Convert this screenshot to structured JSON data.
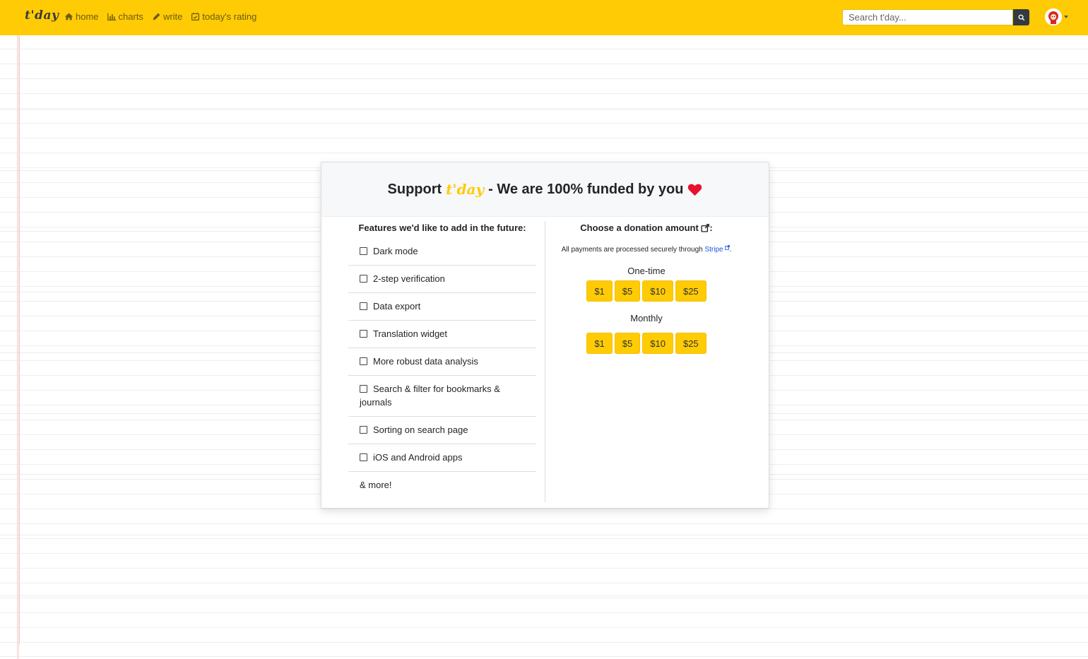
{
  "navbar": {
    "brand": "t'day",
    "links": [
      {
        "label": "home",
        "icon": "home-icon"
      },
      {
        "label": "charts",
        "icon": "bar-chart-icon"
      },
      {
        "label": "write",
        "icon": "pencil-icon"
      },
      {
        "label": "today's rating",
        "icon": "calendar-check-icon"
      }
    ],
    "search_placeholder": "Search t'day...",
    "accent_color": "#ffcb05"
  },
  "support": {
    "title_prefix": "Support",
    "title_brand": "t'day",
    "title_suffix": "- We are 100% funded by you",
    "heart_color": "#e8112d",
    "features_title": "Features we'd like to add in the future:",
    "features": [
      "Dark mode",
      "2-step verification",
      "Data export",
      "Translation widget",
      "More robust data analysis",
      "Search & filter for bookmarks & journals",
      "Sorting on search page",
      "iOS and Android apps"
    ],
    "more": "& more!",
    "donation_title": "Choose a donation amount",
    "donation_colon": ":",
    "payment_note": "All payments are processed securely through",
    "payment_link": "Stripe",
    "payment_period": ".",
    "one_time_label": "One-time",
    "monthly_label": "Monthly",
    "one_time_amounts": [
      "$1",
      "$5",
      "$10",
      "$25"
    ],
    "monthly_amounts": [
      "$1",
      "$5",
      "$10",
      "$25"
    ]
  }
}
